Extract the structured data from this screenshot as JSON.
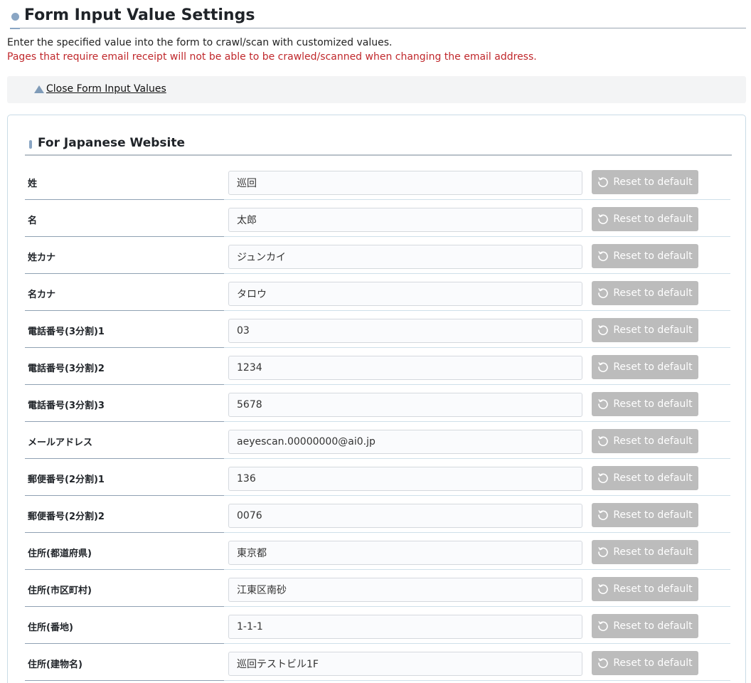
{
  "header": {
    "title": "Form Input Value Settings",
    "description": "Enter the specified value into the form to crawl/scan with customized values.",
    "warning": "Pages that require email receipt will not be able to be crawled/scanned when changing the email address."
  },
  "toggle": {
    "label": "Close Form Input Values",
    "icon": "triangle-up-icon"
  },
  "section": {
    "title": "For Japanese Website"
  },
  "reset_label": "Reset to default",
  "rows": [
    {
      "label": "姓",
      "value": "巡回"
    },
    {
      "label": "名",
      "value": "太郎"
    },
    {
      "label": "姓カナ",
      "value": "ジュンカイ"
    },
    {
      "label": "名カナ",
      "value": "タロウ"
    },
    {
      "label": "電話番号(3分割)1",
      "value": "03"
    },
    {
      "label": "電話番号(3分割)2",
      "value": "1234"
    },
    {
      "label": "電話番号(3分割)3",
      "value": "5678"
    },
    {
      "label": "メールアドレス",
      "value": "aeyescan.00000000@ai0.jp"
    },
    {
      "label": "郵便番号(2分割)1",
      "value": "136"
    },
    {
      "label": "郵便番号(2分割)2",
      "value": "0076"
    },
    {
      "label": "住所(都道府県)",
      "value": "東京都"
    },
    {
      "label": "住所(市区町村)",
      "value": "江東区南砂"
    },
    {
      "label": "住所(番地)",
      "value": "1-1-1"
    },
    {
      "label": "住所(建物名)",
      "value": "巡回テストビル1F"
    }
  ],
  "colors": {
    "accent": "#8aa6c4",
    "warning": "#c0282c",
    "reset_button": "#bcbcbc"
  }
}
